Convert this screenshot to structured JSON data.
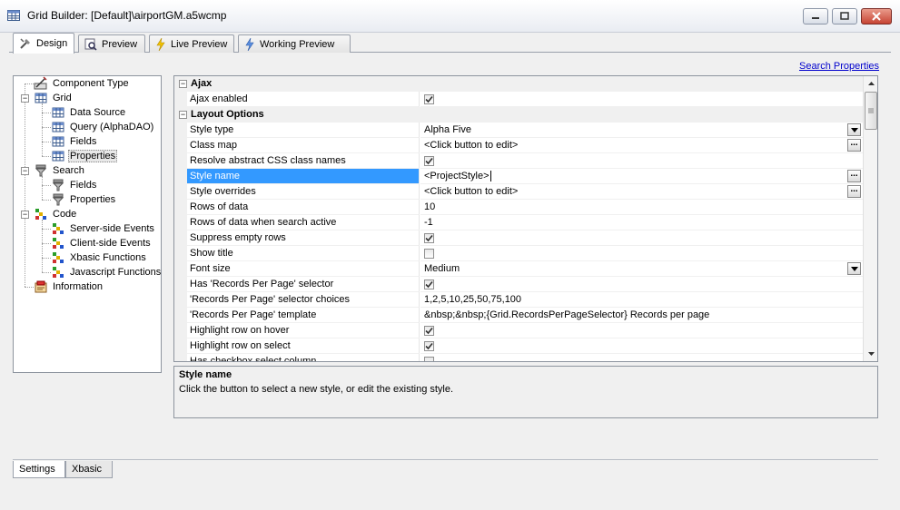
{
  "window": {
    "title": "Grid Builder: [Default]\\airportGM.a5wcmp"
  },
  "tabs": [
    {
      "label": "Design",
      "icon": "design-icon"
    },
    {
      "label": "Preview",
      "icon": "preview-icon"
    },
    {
      "label": "Live Preview",
      "icon": "lightning-icon"
    },
    {
      "label": "Working Preview",
      "icon": "lightning-icon"
    }
  ],
  "search_link": "Search Properties",
  "tree": [
    {
      "label": "Component Type"
    },
    {
      "label": "Grid"
    },
    {
      "label": "Data Source"
    },
    {
      "label": "Query (AlphaDAO)"
    },
    {
      "label": "Fields"
    },
    {
      "label": "Properties"
    },
    {
      "label": "Search"
    },
    {
      "label": "Fields"
    },
    {
      "label": "Properties"
    },
    {
      "label": "Code"
    },
    {
      "label": "Server-side Events"
    },
    {
      "label": "Client-side Events"
    },
    {
      "label": "Xbasic Functions"
    },
    {
      "label": "Javascript Functions"
    },
    {
      "label": "Information"
    }
  ],
  "properties": {
    "categories": [
      "Ajax",
      "Layout Options"
    ],
    "rows": [
      {
        "name": "Ajax enabled",
        "value": "",
        "checked": true
      },
      {
        "name": "Style type",
        "value": "Alpha Five"
      },
      {
        "name": "Class map",
        "value": "<Click button to edit>"
      },
      {
        "name": "Resolve abstract CSS class names",
        "value": "",
        "checked": true
      },
      {
        "name": "Style name",
        "value": "<ProjectStyle>"
      },
      {
        "name": "Style overrides",
        "value": "<Click button to edit>"
      },
      {
        "name": "Rows of data",
        "value": "10"
      },
      {
        "name": "Rows of data when search active",
        "value": "-1"
      },
      {
        "name": "Suppress empty rows",
        "value": "",
        "checked": true
      },
      {
        "name": "Show title",
        "value": "",
        "checked": false
      },
      {
        "name": "Font size",
        "value": "Medium"
      },
      {
        "name": "Has 'Records Per Page' selector",
        "value": "",
        "checked": true
      },
      {
        "name": "'Records Per Page' selector choices",
        "value": "1,2,5,10,25,50,75,100"
      },
      {
        "name": "'Records Per Page' template",
        "value": "&nbsp;&nbsp;{Grid.RecordsPerPageSelector} Records per page"
      },
      {
        "name": "Highlight row on hover",
        "value": "",
        "checked": true
      },
      {
        "name": "Highlight row on select",
        "value": "",
        "checked": true
      },
      {
        "name": "Has checkbox select column",
        "value": "",
        "checked": false
      }
    ]
  },
  "description": {
    "title": "Style name",
    "text": "Click the button to select a new style, or edit the existing style."
  },
  "bottom_tabs": [
    {
      "label": "Settings"
    },
    {
      "label": "Xbasic"
    }
  ]
}
